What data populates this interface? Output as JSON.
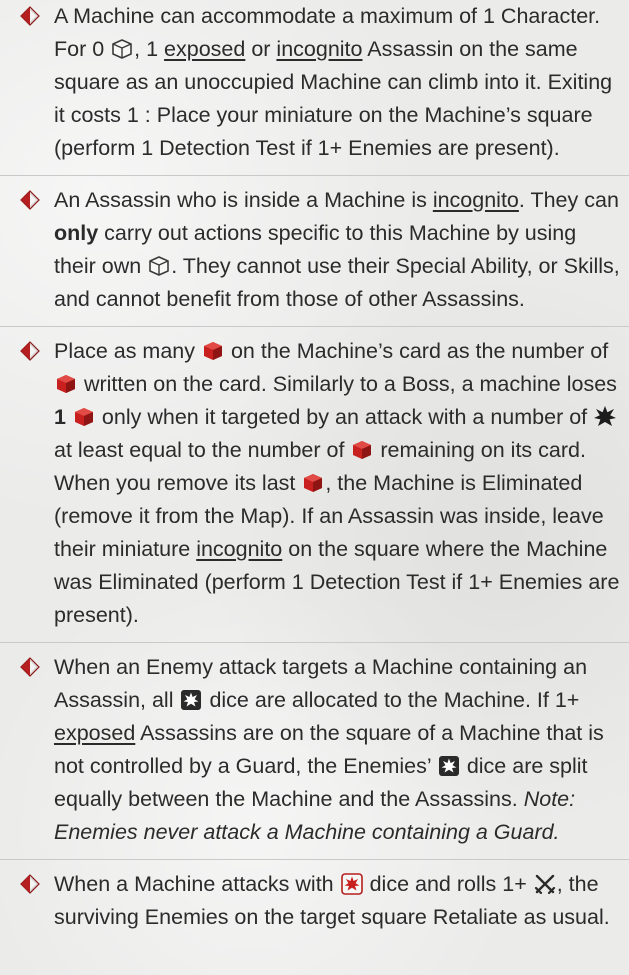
{
  "rules": [
    {
      "p1": "A Machine can accommodate a maximum of 1 Character. For 0 ",
      "p2": ", 1 ",
      "exposed": "exposed",
      "p3": " or ",
      "incognito": "incognito",
      "p4": " Assassin on the same square as an unoccupied Machine can climb into it. Exiting it costs 1 : Place your miniature on the Machine’s square (perform 1 Detection Test if 1+ Enemies are present)."
    },
    {
      "p1": "An Assassin who is inside a Machine is ",
      "incognito": "incognito",
      "p2": ". They can ",
      "only": "only",
      "p3": " carry out actions specific to this Machine by using their own ",
      "p4": ". They cannot use their Special Ability, or Skills, and cannot benefit from those of other Assassins."
    },
    {
      "p1": "Place as many ",
      "p2": " on the Machine’s card as the number of ",
      "p3": " written on the card. Similarly to a Boss, a machine loses ",
      "one": "1",
      "p4": " only when it targeted by an attack with a number of ",
      "p5": " at least equal to the number of ",
      "p6": " remaining on its card. When you remove its last ",
      "p7": ", the Machine is Eliminated (remove it from the Map). If an Assassin was inside, leave their miniature ",
      "incognito": "incognito",
      "p8": " on the square where the Machine was Eliminated (perform 1 Detection Test if 1+ Enemies are present)."
    },
    {
      "p1": "When an Enemy attack targets a Machine containing an Assassin, all ",
      "p2": " dice are allocated to the Machine. If 1+ ",
      "exposed": "exposed",
      "p3": " Assassins are on the square of a Machine that is not controlled by a Guard, the Enemies’ ",
      "p4": " dice are split equally between the Machine and the Assassins. ",
      "note": "Note: Enemies never attack a Machine containing a Guard."
    },
    {
      "p1": "When a Machine attacks with ",
      "p2": " dice and rolls 1+ ",
      "p3": ", the surviving Enemies on the target square Retaliate as usual."
    }
  ],
  "icons": {
    "bullet": "red-diamond-bullet-icon",
    "action_cube": "white-action-cube-icon",
    "health_cube": "red-health-cube-icon",
    "hit_star": "black-hit-star-icon",
    "enemy_die": "black-enemy-die-icon",
    "assassin_die": "white-red-attack-die-icon",
    "crossed_swords": "crossed-swords-icon"
  },
  "colors": {
    "text": "#2b2b2b",
    "accent_red": "#b51f1f",
    "background": "#ebebea"
  }
}
